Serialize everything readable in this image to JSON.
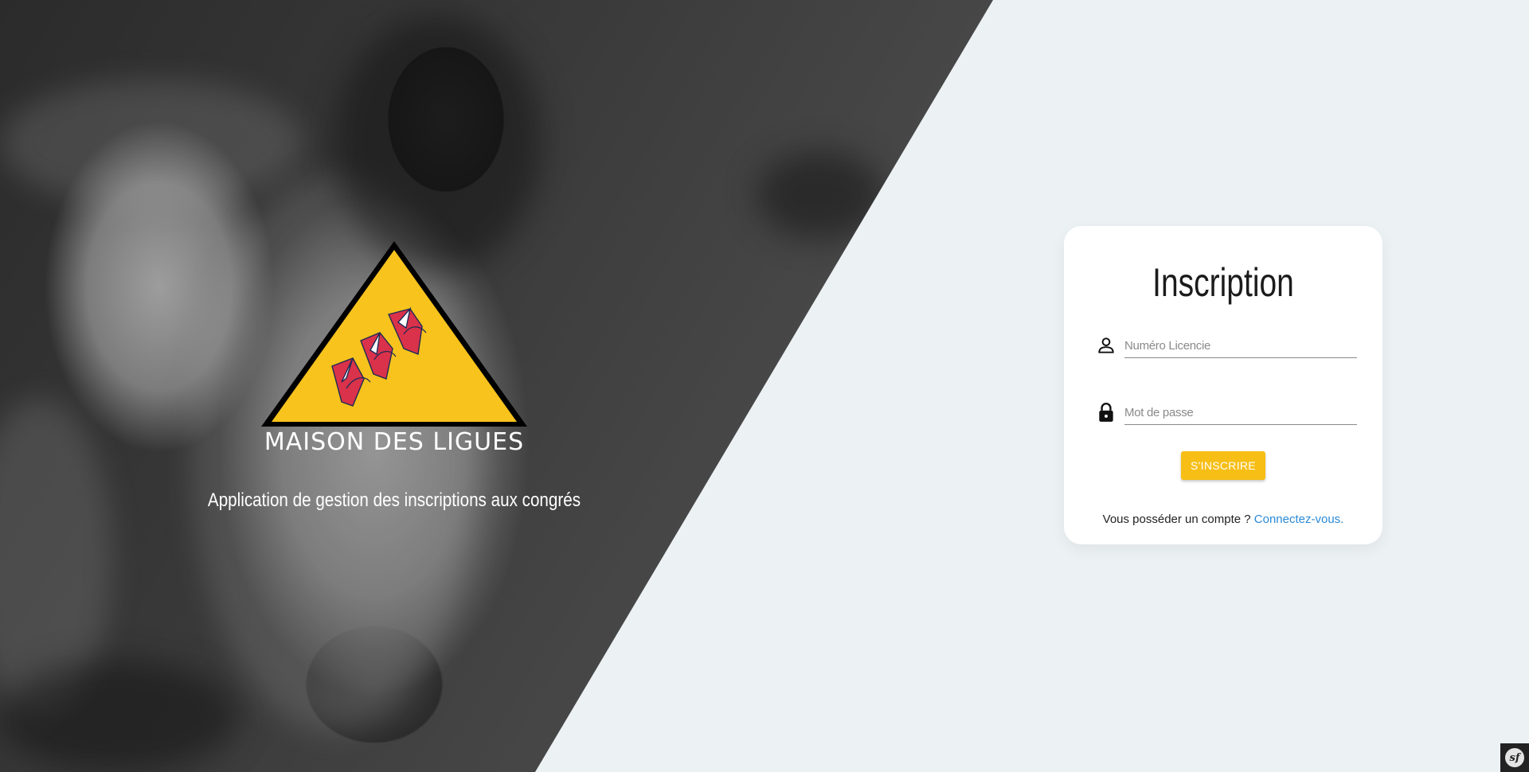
{
  "hero": {
    "logo_text": "MAISON DES LIGUES",
    "tagline": "Application de gestion des inscriptions aux congrés"
  },
  "form": {
    "title": "Inscription",
    "license_field": {
      "placeholder": "Numéro Licencie",
      "icon": "user-icon"
    },
    "password_field": {
      "placeholder": "Mot de passe",
      "icon": "lock-icon"
    },
    "submit_label": "S'INSCRIRE",
    "account_prompt": "Vous posséder un compte ?",
    "login_link": "Connectez-vous."
  },
  "debug_toolbar": {
    "label": "sf"
  },
  "colors": {
    "accent": "#f7be16",
    "link": "#2a8ad8",
    "background": "#ecf1f4"
  }
}
